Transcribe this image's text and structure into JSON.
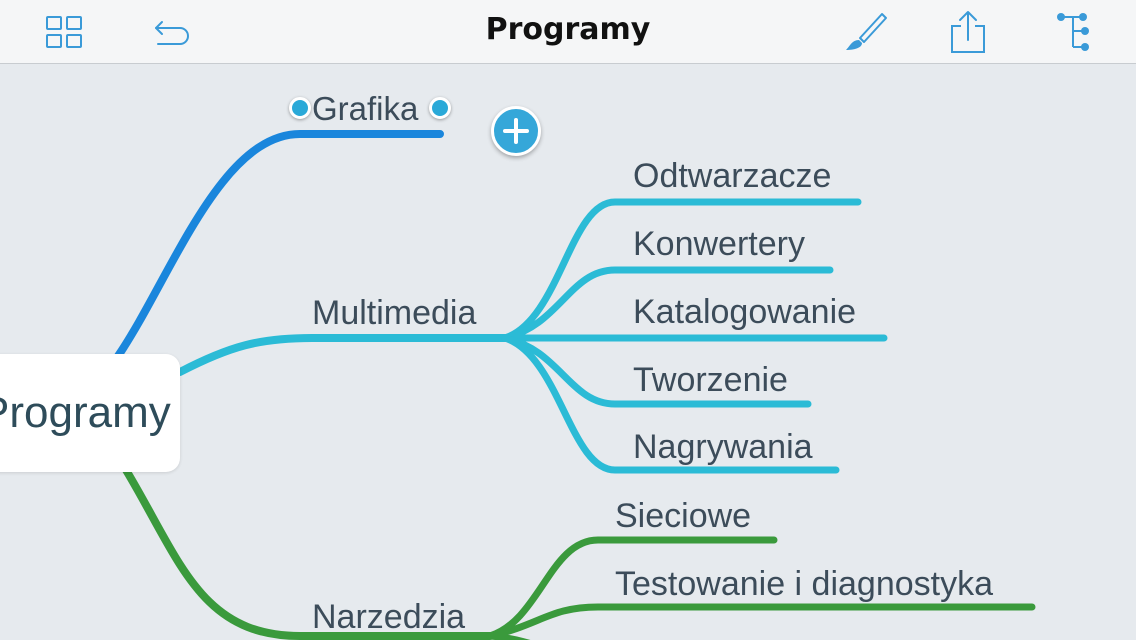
{
  "toolbar": {
    "title": "Programy",
    "icons": [
      "grid-icon",
      "undo-icon",
      "brush-icon",
      "share-icon",
      "outline-icon"
    ]
  },
  "mindmap": {
    "central": "Programy",
    "branches": [
      {
        "label": "Grafika",
        "color": "#1a86dc",
        "selected": true
      },
      {
        "label": "Multimedia",
        "color": "#2bbbd6",
        "children": [
          "Odtwarzacze",
          "Konwertery",
          "Katalogowanie",
          "Tworzenie",
          "Nagrywania"
        ]
      },
      {
        "label": "Narzedzia",
        "color": "#3a9a3c",
        "children": [
          "Sieciowe",
          "Testowanie i diagnostyka"
        ]
      }
    ]
  },
  "colors": {
    "accent": "#35a7d9",
    "selection_handle": "#2aa9d8",
    "background": "#e6eaee"
  }
}
